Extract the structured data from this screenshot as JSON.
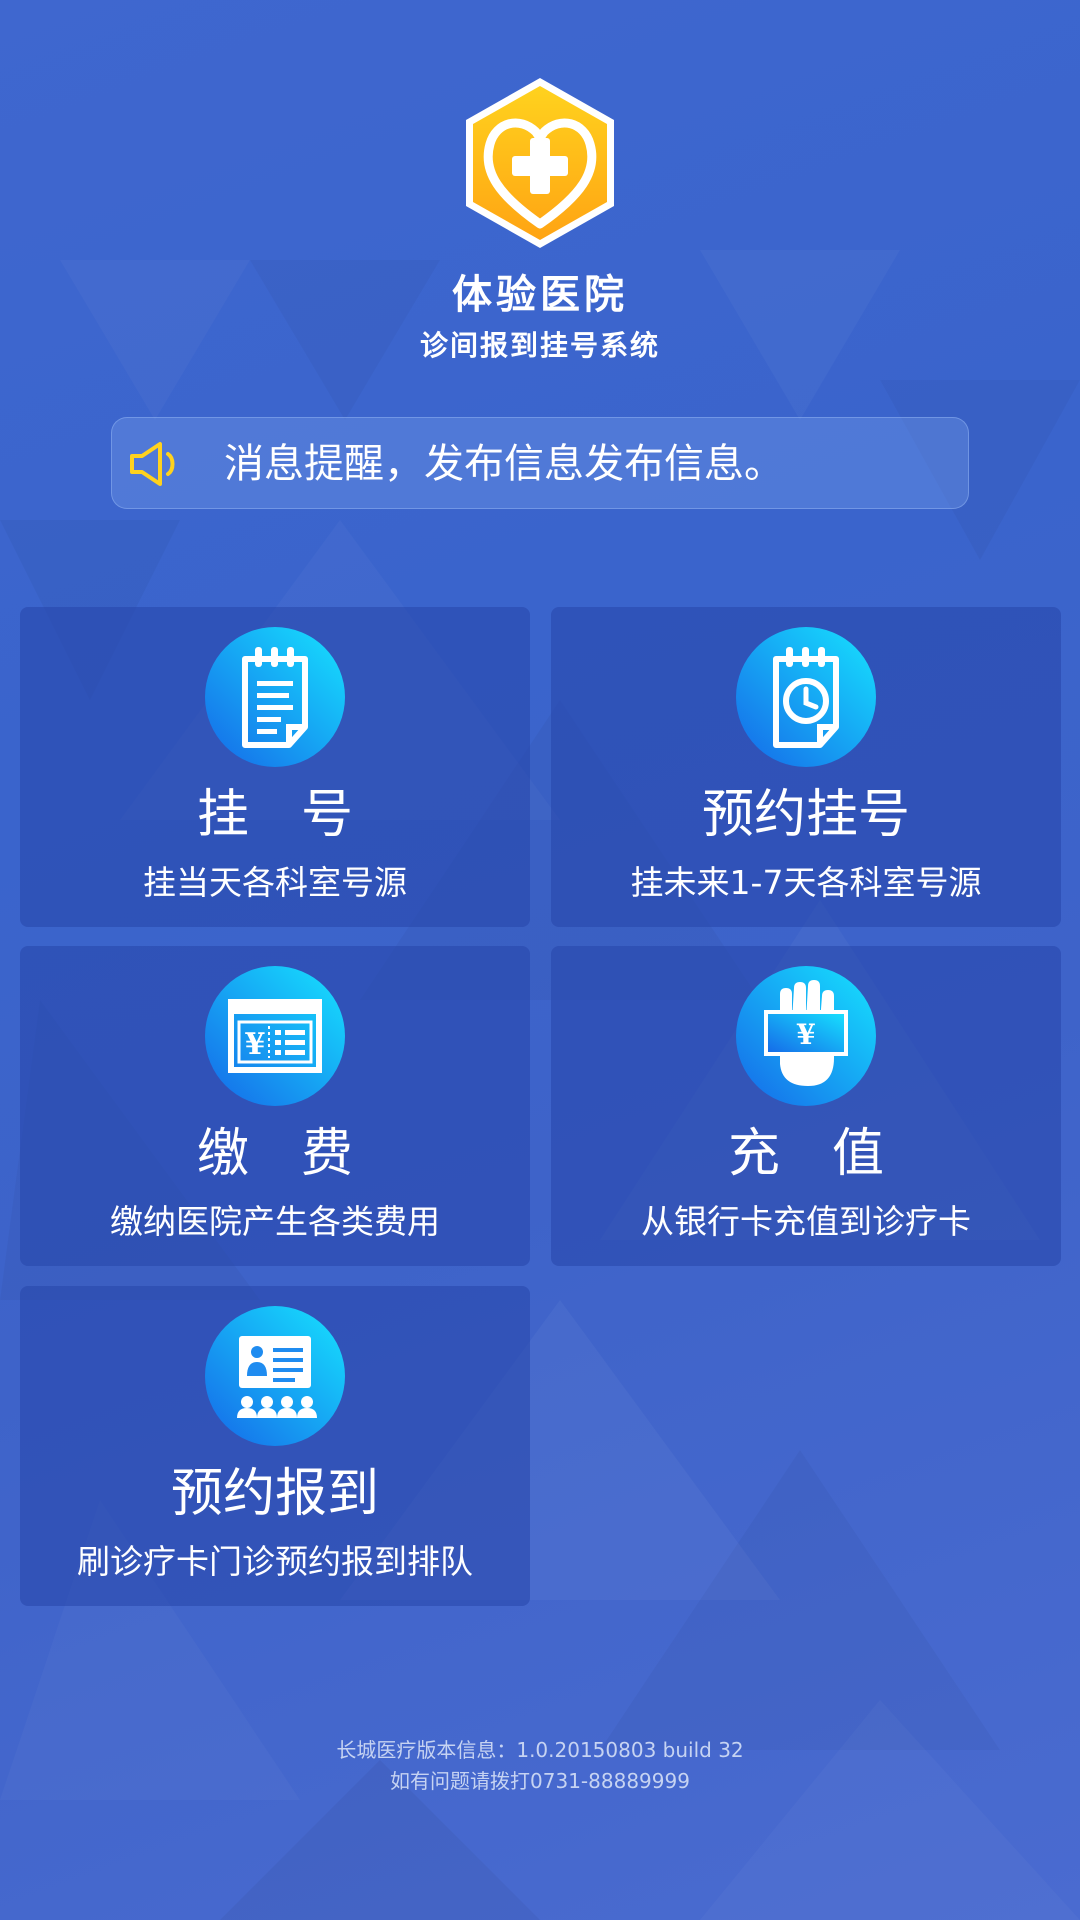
{
  "colors": {
    "background": "#3f67cf",
    "tile": "#2f55b5",
    "icon_gradient_start": "#17e3ff",
    "icon_gradient_end": "#1568e8",
    "logo_gold": "#ffb616",
    "speaker_yellow": "#ffd21e",
    "text": "#ffffff",
    "footer_text": "#c6d3f2"
  },
  "header": {
    "logo_icon": "hospital-heart-cross-icon",
    "title": "体验医院",
    "subtitle": "诊间报到挂号系统"
  },
  "notice": {
    "icon": "speaker-icon",
    "text": "消息提醒，发布信息发布信息。"
  },
  "menu": [
    {
      "icon": "notepad-icon",
      "title": "挂　号",
      "desc": "挂当天各科室号源"
    },
    {
      "icon": "notepad-clock-icon",
      "title": "预约挂号",
      "desc": "挂未来1-7天各科室号源"
    },
    {
      "icon": "bill-yuan-icon",
      "title": "缴　费",
      "desc": "缴纳医院产生各类费用"
    },
    {
      "icon": "hand-banknote-icon",
      "title": "充　值",
      "desc": "从银行卡充值到诊疗卡"
    },
    {
      "icon": "id-card-queue-icon",
      "title": "预约报到",
      "desc": "刷诊疗卡门诊预约报到排队"
    }
  ],
  "footer": {
    "version": "长城医疗版本信息：1.0.20150803 build 32",
    "contact": "如有问题请拨打0731-88889999"
  }
}
